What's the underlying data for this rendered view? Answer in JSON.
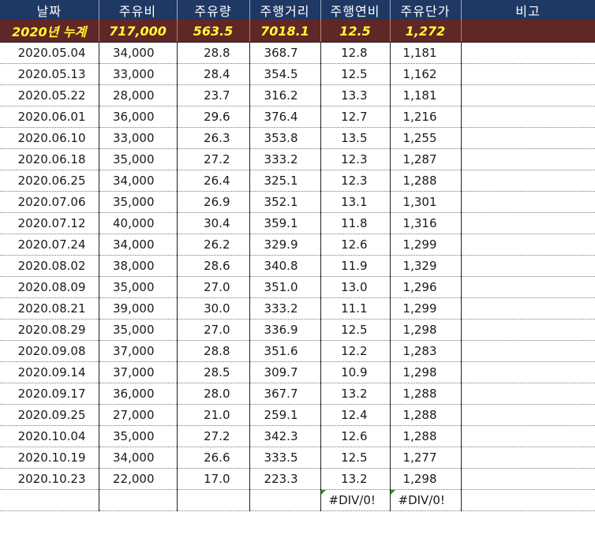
{
  "headers": [
    "날짜",
    "주유비",
    "주유량",
    "주행거리",
    "주행연비",
    "주유단가",
    "비고"
  ],
  "total": {
    "label": "2020년 누계",
    "cost": "717,000",
    "amount": "563.5",
    "distance": "7018.1",
    "efficiency": "12.5",
    "unit_price": "1,272",
    "note": ""
  },
  "rows": [
    {
      "date": "2020.05.04",
      "cost": "34,000",
      "amount": "28.8",
      "distance": "368.7",
      "efficiency": "12.8",
      "unit_price": "1,181",
      "note": ""
    },
    {
      "date": "2020.05.13",
      "cost": "33,000",
      "amount": "28.4",
      "distance": "354.5",
      "efficiency": "12.5",
      "unit_price": "1,162",
      "note": ""
    },
    {
      "date": "2020.05.22",
      "cost": "28,000",
      "amount": "23.7",
      "distance": "316.2",
      "efficiency": "13.3",
      "unit_price": "1,181",
      "note": ""
    },
    {
      "date": "2020.06.01",
      "cost": "36,000",
      "amount": "29.6",
      "distance": "376.4",
      "efficiency": "12.7",
      "unit_price": "1,216",
      "note": ""
    },
    {
      "date": "2020.06.10",
      "cost": "33,000",
      "amount": "26.3",
      "distance": "353.8",
      "efficiency": "13.5",
      "unit_price": "1,255",
      "note": ""
    },
    {
      "date": "2020.06.18",
      "cost": "35,000",
      "amount": "27.2",
      "distance": "333.2",
      "efficiency": "12.3",
      "unit_price": "1,287",
      "note": ""
    },
    {
      "date": "2020.06.25",
      "cost": "34,000",
      "amount": "26.4",
      "distance": "325.1",
      "efficiency": "12.3",
      "unit_price": "1,288",
      "note": ""
    },
    {
      "date": "2020.07.06",
      "cost": "35,000",
      "amount": "26.9",
      "distance": "352.1",
      "efficiency": "13.1",
      "unit_price": "1,301",
      "note": ""
    },
    {
      "date": "2020.07.12",
      "cost": "40,000",
      "amount": "30.4",
      "distance": "359.1",
      "efficiency": "11.8",
      "unit_price": "1,316",
      "note": ""
    },
    {
      "date": "2020.07.24",
      "cost": "34,000",
      "amount": "26.2",
      "distance": "329.9",
      "efficiency": "12.6",
      "unit_price": "1,299",
      "note": ""
    },
    {
      "date": "2020.08.02",
      "cost": "38,000",
      "amount": "28.6",
      "distance": "340.8",
      "efficiency": "11.9",
      "unit_price": "1,329",
      "note": ""
    },
    {
      "date": "2020.08.09",
      "cost": "35,000",
      "amount": "27.0",
      "distance": "351.0",
      "efficiency": "13.0",
      "unit_price": "1,296",
      "note": ""
    },
    {
      "date": "2020.08.21",
      "cost": "39,000",
      "amount": "30.0",
      "distance": "333.2",
      "efficiency": "11.1",
      "unit_price": "1,299",
      "note": ""
    },
    {
      "date": "2020.08.29",
      "cost": "35,000",
      "amount": "27.0",
      "distance": "336.9",
      "efficiency": "12.5",
      "unit_price": "1,298",
      "note": ""
    },
    {
      "date": "2020.09.08",
      "cost": "37,000",
      "amount": "28.8",
      "distance": "351.6",
      "efficiency": "12.2",
      "unit_price": "1,283",
      "note": ""
    },
    {
      "date": "2020.09.14",
      "cost": "37,000",
      "amount": "28.5",
      "distance": "309.7",
      "efficiency": "10.9",
      "unit_price": "1,298",
      "note": ""
    },
    {
      "date": "2020.09.17",
      "cost": "36,000",
      "amount": "28.0",
      "distance": "367.7",
      "efficiency": "13.2",
      "unit_price": "1,288",
      "note": ""
    },
    {
      "date": "2020.09.25",
      "cost": "27,000",
      "amount": "21.0",
      "distance": "259.1",
      "efficiency": "12.4",
      "unit_price": "1,288",
      "note": ""
    },
    {
      "date": "2020.10.04",
      "cost": "35,000",
      "amount": "27.2",
      "distance": "342.3",
      "efficiency": "12.6",
      "unit_price": "1,288",
      "note": ""
    },
    {
      "date": "2020.10.19",
      "cost": "34,000",
      "amount": "26.6",
      "distance": "333.5",
      "efficiency": "12.5",
      "unit_price": "1,277",
      "note": ""
    },
    {
      "date": "2020.10.23",
      "cost": "22,000",
      "amount": "17.0",
      "distance": "223.3",
      "efficiency": "13.2",
      "unit_price": "1,298",
      "note": ""
    },
    {
      "date": "",
      "cost": "",
      "amount": "",
      "distance": "",
      "efficiency": "#DIV/0!",
      "unit_price": "#DIV/0!",
      "note": ""
    }
  ],
  "colors": {
    "header_bg": "#1f3864",
    "header_text": "#ffffff",
    "total_bg": "#612626",
    "total_text": "#ffff33",
    "error_marker": "#2e8b2e"
  }
}
